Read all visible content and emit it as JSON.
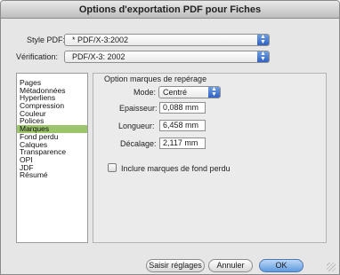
{
  "window": {
    "title": "Options d'exportation PDF pour Fiches"
  },
  "style_pdf": {
    "label": "Style PDF:",
    "value": "* PDF/X-3:2002"
  },
  "verification": {
    "label": "Vérification:",
    "value": "PDF/X-3: 2002"
  },
  "sidebar": {
    "items": [
      {
        "label": "Pages",
        "selected": false
      },
      {
        "label": "Métadonnées",
        "selected": false
      },
      {
        "label": "Hyperliens",
        "selected": false
      },
      {
        "label": "Compression",
        "selected": false
      },
      {
        "label": "Couleur",
        "selected": false
      },
      {
        "label": "Polices",
        "selected": false
      },
      {
        "label": "Marques",
        "selected": true
      },
      {
        "label": "Fond perdu",
        "selected": false
      },
      {
        "label": "Calques",
        "selected": false
      },
      {
        "label": "Transparence",
        "selected": false
      },
      {
        "label": "OPI",
        "selected": false
      },
      {
        "label": "JDF",
        "selected": false
      },
      {
        "label": "Résumé",
        "selected": false
      }
    ],
    "selected_color": "#9cc46a"
  },
  "marks_panel": {
    "title": "Option marques de repérage",
    "mode": {
      "label": "Mode:",
      "value": "Centré"
    },
    "thickness": {
      "label": "Epaisseur:",
      "value": "0,088 mm"
    },
    "length": {
      "label": "Longueur:",
      "value": "6,458 mm"
    },
    "offset": {
      "label": "Décalage:",
      "value": "2,117 mm"
    },
    "include_bleed": {
      "label": "Inclure marques de fond perdu",
      "checked": false
    }
  },
  "buttons": {
    "capture": "Saisir réglages",
    "cancel": "Annuler",
    "ok": "OK"
  },
  "colors": {
    "accent": "#2f63c4",
    "default_button": "#5f9be0"
  }
}
